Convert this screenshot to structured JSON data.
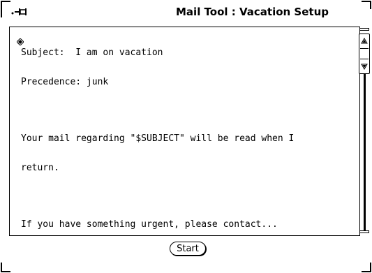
{
  "window": {
    "title": "Mail Tool : Vacation Setup",
    "pushpin_icon": "pushpin-icon"
  },
  "message": {
    "lines": [
      "Subject:  I am on vacation",
      "Precedence: junk",
      "",
      "Your mail regarding \"$SUBJECT\" will be read when I",
      "return.",
      "",
      "If you have something urgent, please contact..."
    ]
  },
  "scrollbar": {
    "up_icon": "scroll-up-arrow-icon",
    "down_icon": "scroll-down-arrow-icon"
  },
  "footer": {
    "start_label": "Start"
  },
  "colors": {
    "foreground": "#000000",
    "background": "#ffffff"
  }
}
